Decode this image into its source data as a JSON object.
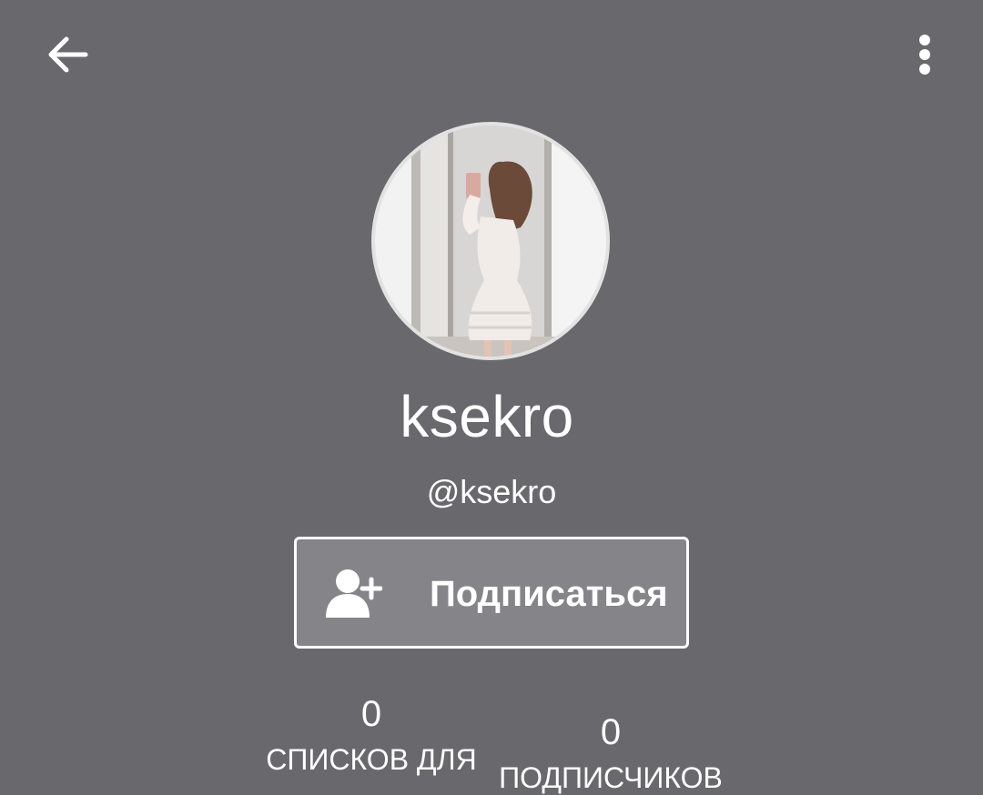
{
  "toolbar": {
    "back_icon": "arrow-left-icon",
    "menu_icon": "more-vertical-icon"
  },
  "profile": {
    "display_name": "ksekro",
    "handle": "@ksekro",
    "avatar_description_icon": "profile-photo"
  },
  "follow_button": {
    "label": "Подписаться",
    "icon": "add-user-icon"
  },
  "stats": [
    {
      "value": "0",
      "label": "СПИСКОВ ДЛЯ"
    },
    {
      "value": "0",
      "label": "ПОДПИСЧИКОВ"
    }
  ],
  "colors": {
    "background": "#69686c",
    "button_fill": "#858488",
    "text": "#ffffff"
  }
}
